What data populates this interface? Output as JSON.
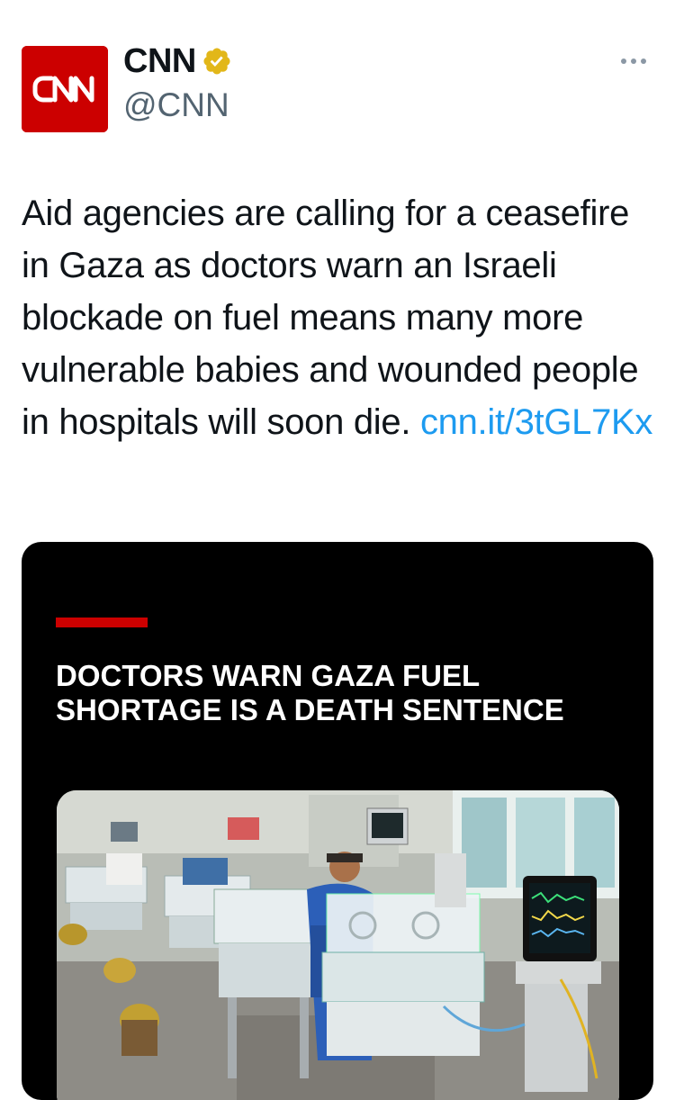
{
  "account": {
    "display_name": "CNN",
    "handle": "@CNN",
    "avatar_logo_text": "CNN",
    "verified": true,
    "verified_badge_color": "#e2b719"
  },
  "tweet": {
    "text": "Aid agencies are calling for a ceasefire in Gaza as doctors warn an Israeli blockade on fuel means many more vulnerable babies and wounded people in hospitals will soon die.",
    "link": "cnn.it/3tGL7Kx",
    "link_color": "#1d9bf0"
  },
  "media_card": {
    "headline": "DOCTORS WARN GAZA FUEL SHORTAGE IS A DEATH SENTENCE",
    "accent_color": "#cc0000",
    "background_color": "#000000",
    "photo_description_icon": "hospital-incubator-photo"
  },
  "icons": {
    "more": "more-horizontal-icon",
    "verified": "verified-badge-icon"
  }
}
